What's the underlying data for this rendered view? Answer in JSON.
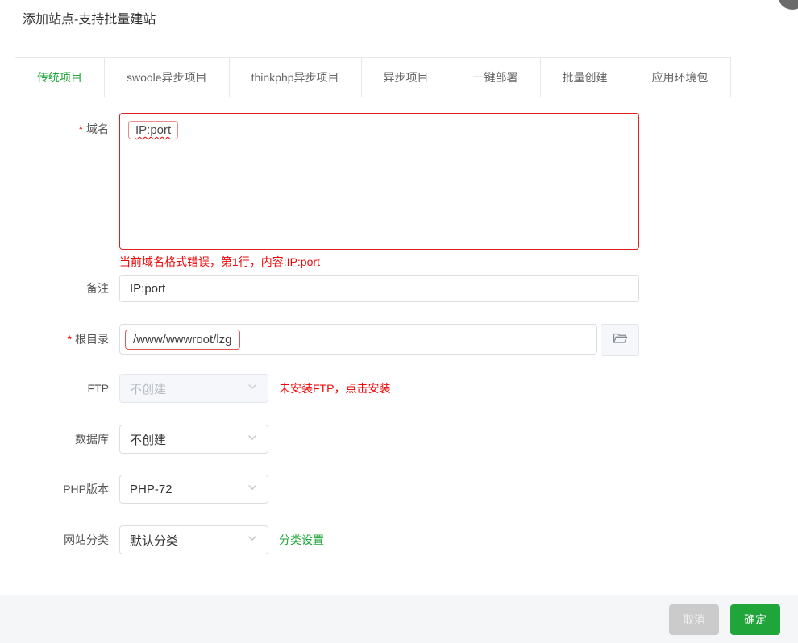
{
  "header": {
    "title": "添加站点-支持批量建站"
  },
  "tabs": [
    {
      "label": "传统项目"
    },
    {
      "label": "swoole异步项目"
    },
    {
      "label": "thinkphp异步项目"
    },
    {
      "label": "异步项目"
    },
    {
      "label": "一键部署"
    },
    {
      "label": "批量创建"
    },
    {
      "label": "应用环境包"
    }
  ],
  "form": {
    "required_mark": "*",
    "domain": {
      "label": "域名",
      "value": "IP:port",
      "error": "当前域名格式错误，第1行，内容:IP:port"
    },
    "note": {
      "label": "备注",
      "value": "IP:port"
    },
    "root": {
      "label": "根目录",
      "value": "/www/wwwroot/lzg"
    },
    "ftp": {
      "label": "FTP",
      "selected": "不创建",
      "hint": "未安装FTP，点击安装"
    },
    "database": {
      "label": "数据库",
      "selected": "不创建"
    },
    "php": {
      "label": "PHP版本",
      "selected": "PHP-72"
    },
    "category": {
      "label": "网站分类",
      "selected": "默认分类",
      "link": "分类设置"
    }
  },
  "footer": {
    "cancel_label": "取消",
    "confirm_label": "确定"
  },
  "colors": {
    "accent_green": "#20a53a",
    "error_red": "#ef0808",
    "domain_border_red": "#e02020"
  }
}
